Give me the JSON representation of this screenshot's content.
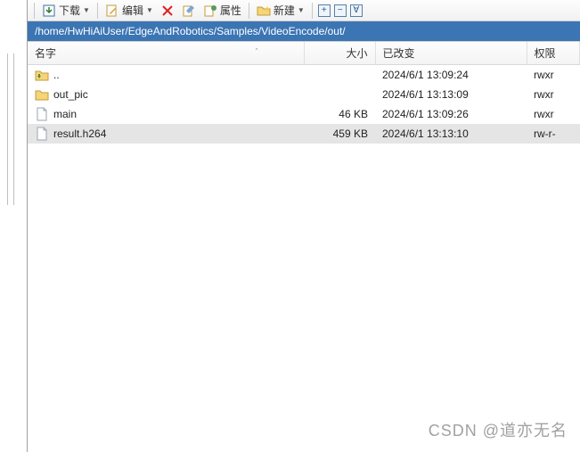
{
  "toolbar": {
    "download": "下载",
    "edit": "编辑",
    "properties": "属性",
    "new": "新建"
  },
  "path": "/home/HwHiAiUser/EdgeAndRobotics/Samples/VideoEncode/out/",
  "columns": {
    "name": "名字",
    "size": "大小",
    "changed": "已改变",
    "perm": "权限"
  },
  "rows": [
    {
      "icon": "up",
      "name": "..",
      "size": "",
      "changed": "2024/6/1 13:09:24",
      "perm": "rwxr",
      "sel": false
    },
    {
      "icon": "folder",
      "name": "out_pic",
      "size": "",
      "changed": "2024/6/1 13:13:09",
      "perm": "rwxr",
      "sel": false
    },
    {
      "icon": "file",
      "name": "main",
      "size": "46 KB",
      "changed": "2024/6/1 13:09:26",
      "perm": "rwxr",
      "sel": false
    },
    {
      "icon": "file",
      "name": "result.h264",
      "size": "459 KB",
      "changed": "2024/6/1 13:13:10",
      "perm": "rw-r-",
      "sel": true
    }
  ],
  "watermark": "CSDN @道亦无名"
}
